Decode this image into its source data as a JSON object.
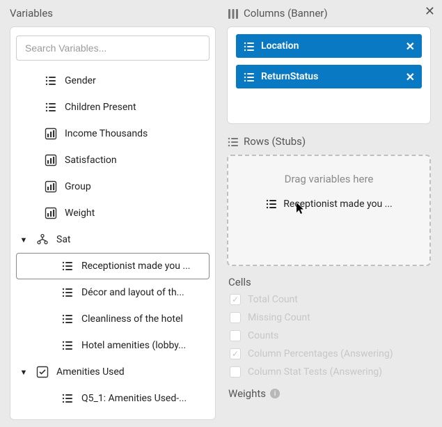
{
  "left": {
    "title": "Variables",
    "search_placeholder": "Search Variables...",
    "items": [
      {
        "label": "Gender",
        "icon": "list",
        "indent": 1
      },
      {
        "label": "Children Present",
        "icon": "list",
        "indent": 1
      },
      {
        "label": "Income Thousands",
        "icon": "bars",
        "indent": 1
      },
      {
        "label": "Satisfaction",
        "icon": "bars",
        "indent": 1
      },
      {
        "label": "Group",
        "icon": "bars",
        "indent": 1
      },
      {
        "label": "Weight",
        "icon": "bars",
        "indent": 1
      },
      {
        "label": "Sat",
        "icon": "cluster",
        "indent": 0,
        "expander": "▼"
      },
      {
        "label": "Receptionist made you ...",
        "icon": "list",
        "indent": 2,
        "selected": true
      },
      {
        "label": "Décor and layout of th...",
        "icon": "list",
        "indent": 2
      },
      {
        "label": "Cleanliness of the hotel",
        "icon": "list",
        "indent": 2
      },
      {
        "label": "Hotel amenities (lobby...",
        "icon": "list",
        "indent": 2
      },
      {
        "label": "Amenities Used",
        "icon": "check",
        "indent": 0,
        "expander": "▼"
      },
      {
        "label": "Q5_1: Amenities Used-...",
        "icon": "list",
        "indent": 2
      }
    ]
  },
  "columns": {
    "title": "Columns (Banner)",
    "pills": [
      {
        "label": "Location"
      },
      {
        "label": "ReturnStatus"
      }
    ]
  },
  "rows": {
    "title": "Rows (Stubs)",
    "hint": "Drag variables here",
    "ghost_label": "Receptionist made you ..."
  },
  "cells": {
    "title": "Cells",
    "options": [
      {
        "label": "Total Count",
        "checked": true
      },
      {
        "label": "Missing Count",
        "checked": false
      },
      {
        "label": "Counts",
        "checked": false
      },
      {
        "label": "Column Percentages (Answering)",
        "checked": true
      },
      {
        "label": "Column Stat Tests (Answering)",
        "checked": false
      }
    ]
  },
  "weights": {
    "title": "Weights"
  }
}
